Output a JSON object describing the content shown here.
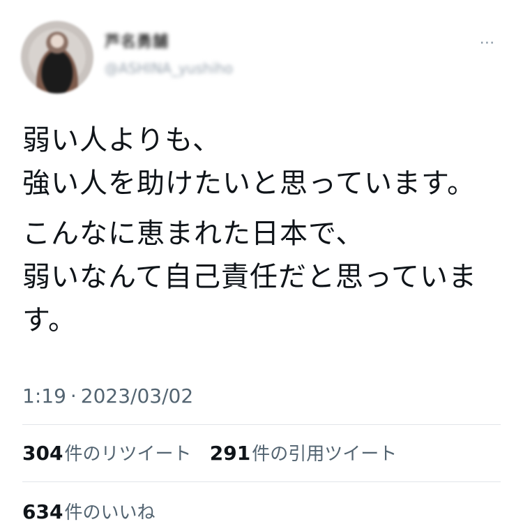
{
  "author": {
    "display_name": "芦名勇舗",
    "handle": "@ASHINA_yushiho"
  },
  "more_icon": "⋯",
  "tweet": {
    "paragraphs": [
      "弱い人よりも、\n強い人を助けたいと思っています。",
      "こんなに恵まれた日本で、\n弱いなんて自己責任だと思っていま\nす。"
    ],
    "time": "1:19",
    "separator": "·",
    "date": "2023/03/02"
  },
  "stats": {
    "retweets_count": "304",
    "retweets_label": "件のリツイート",
    "quotes_count": "291",
    "quotes_label": "件の引用ツイート",
    "likes_count": "634",
    "likes_label": "件のいいね"
  },
  "colors": {
    "text": "#0f1419",
    "secondary": "#536471",
    "divider": "#e1e5e9"
  }
}
